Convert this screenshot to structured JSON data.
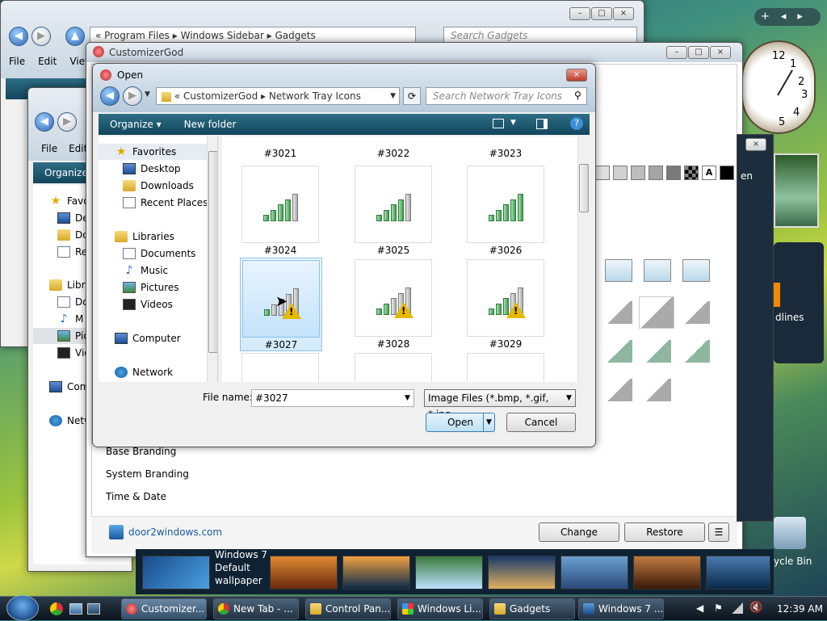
{
  "back_window": {
    "address": [
      "Program Files",
      "Windows Sidebar",
      "Gadgets"
    ],
    "search_placeholder": "Search Gadgets",
    "menu": [
      "File",
      "Edit",
      "View"
    ]
  },
  "mid_window": {
    "menu": [
      "File",
      "Edit"
    ],
    "organize": "Organize",
    "nav_fragments": [
      "Favo",
      "De",
      "Do",
      "Re",
      "Libra",
      "Do",
      "M",
      "Pic",
      "Vid",
      "Comp",
      "Netw"
    ],
    "side_fragment": "Organ"
  },
  "main_window": {
    "title": "CustomizerGod",
    "side_list": [
      "Base Branding",
      "System Branding",
      "Time & Date"
    ],
    "footer_link": "door2windows.com",
    "change_label": "Change",
    "restore_label": "Restore",
    "menu_label": "☰",
    "right_fragments": [
      "en",
      "dlines"
    ]
  },
  "dialog": {
    "title": "Open",
    "address_prefix": "«",
    "address": [
      "CustomizerGod",
      "Network Tray Icons"
    ],
    "search_placeholder": "Search Network Tray Icons",
    "toolbar": {
      "organize": "Organize ▾",
      "new_folder": "New folder"
    },
    "nav": {
      "favorites": "Favorites",
      "desktop": "Desktop",
      "downloads": "Downloads",
      "recent": "Recent Places",
      "libraries": "Libraries",
      "documents": "Documents",
      "music": "Music",
      "pictures": "Pictures",
      "videos": "Videos",
      "computer": "Computer",
      "network": "Network"
    },
    "top_labels": [
      "#3021",
      "#3022",
      "#3023"
    ],
    "tiles": [
      {
        "label": "#3024",
        "green": 4,
        "warn": false
      },
      {
        "label": "#3025",
        "green": 4,
        "warn": false
      },
      {
        "label": "#3026",
        "green": 5,
        "warn": false
      },
      {
        "label": "#3027",
        "green": 1,
        "warn": true,
        "selected": true
      },
      {
        "label": "#3028",
        "green": 2,
        "warn": true
      },
      {
        "label": "#3029",
        "green": 3,
        "warn": true
      }
    ],
    "file_name_label": "File name:",
    "file_name_value": "#3027",
    "file_type": "Image Files (*.bmp, *.gif, *.jpg,",
    "open_label": "Open",
    "cancel_label": "Cancel"
  },
  "desktop": {
    "wallpaper_label_1": "Windows 7",
    "wallpaper_label_2": "Default",
    "wallpaper_label_3": "wallpaper",
    "recycle_label": "ycle Bin",
    "clock_numbers": [
      "12",
      "1",
      "2",
      "3",
      "4",
      "5"
    ]
  },
  "taskbar": {
    "items": [
      "Customizer...",
      "New Tab - ...",
      "Control Pan...",
      "Windows Li...",
      "Gadgets",
      "Windows 7 ..."
    ],
    "time": "12:39 AM"
  },
  "colors": {
    "accent": "#12465c",
    "selection": "#c4e3fb",
    "taskbar": "#0b141c"
  }
}
